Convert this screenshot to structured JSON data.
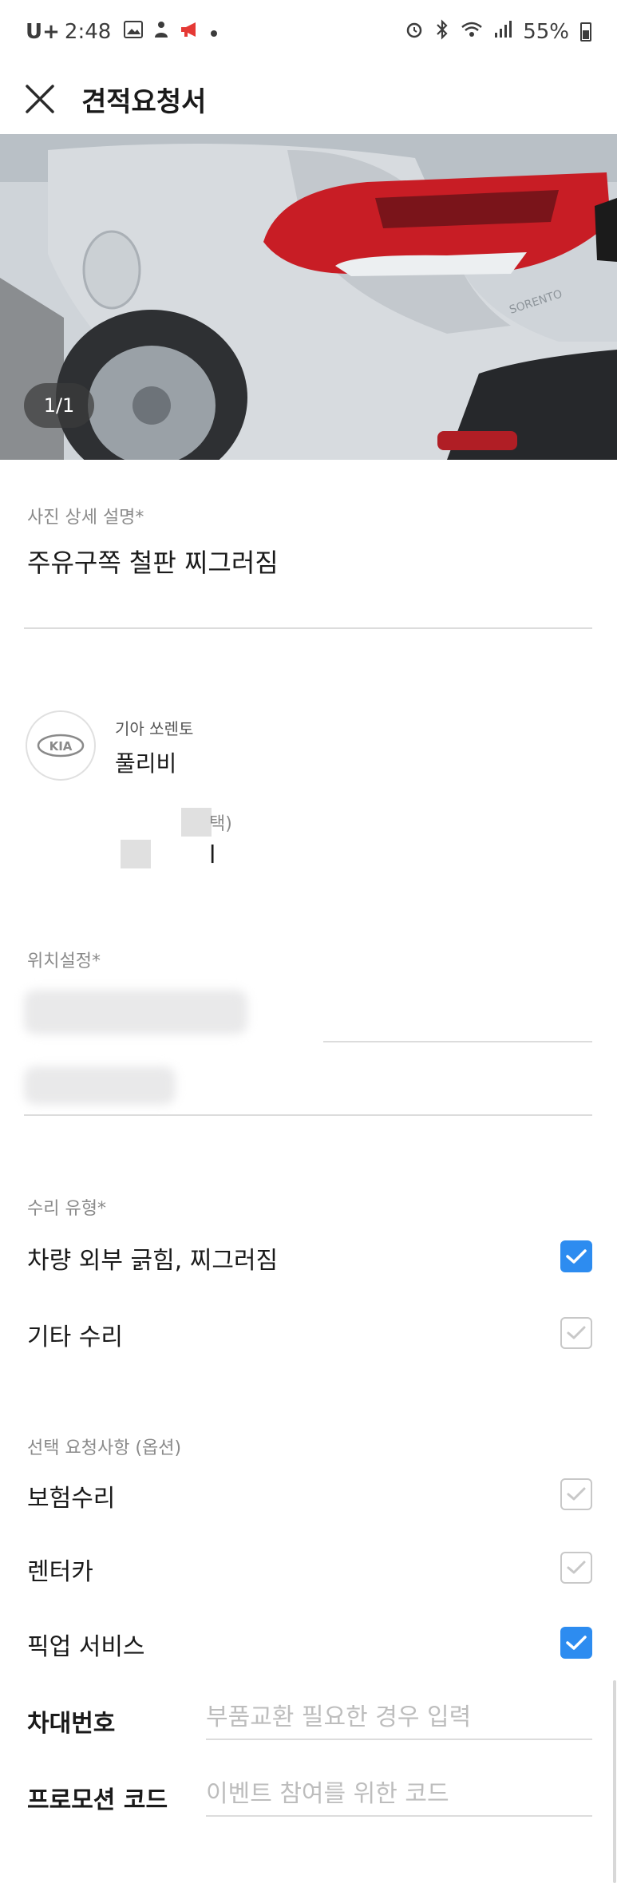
{
  "status_bar": {
    "carrier": "U+",
    "time": "2:48",
    "battery": "55%"
  },
  "header": {
    "title": "견적요청서"
  },
  "photo": {
    "counter": "1/1"
  },
  "description": {
    "label": "사진 상세 설명*",
    "value": "주유구쪽 철판 찌그러짐"
  },
  "vehicle": {
    "brand_logo": "KIA",
    "brand_model": "기아 쏘렌토",
    "trim": "풀리비",
    "partial_text": "택)",
    "cursor_char": "l"
  },
  "location": {
    "label": "위치설정*"
  },
  "repair_type": {
    "label": "수리 유형*",
    "options": [
      {
        "label": "차량 외부 긁힘, 찌그러짐",
        "checked": true
      },
      {
        "label": "기타 수리",
        "checked": false
      }
    ]
  },
  "extras": {
    "label": "선택 요청사항 (옵션)",
    "options": [
      {
        "label": "보험수리",
        "checked": false
      },
      {
        "label": "렌터카",
        "checked": false
      },
      {
        "label": "픽업 서비스",
        "checked": true
      }
    ]
  },
  "fields": {
    "vin": {
      "label": "차대번호",
      "placeholder": "부품교환 필요한 경우 입력"
    },
    "promo": {
      "label": "프로모션 코드",
      "placeholder": "이벤트 참여를 위한 코드"
    }
  },
  "colors": {
    "accent": "#2d8cf0",
    "divider": "#dcdcdc",
    "label": "#8a8a8a"
  }
}
